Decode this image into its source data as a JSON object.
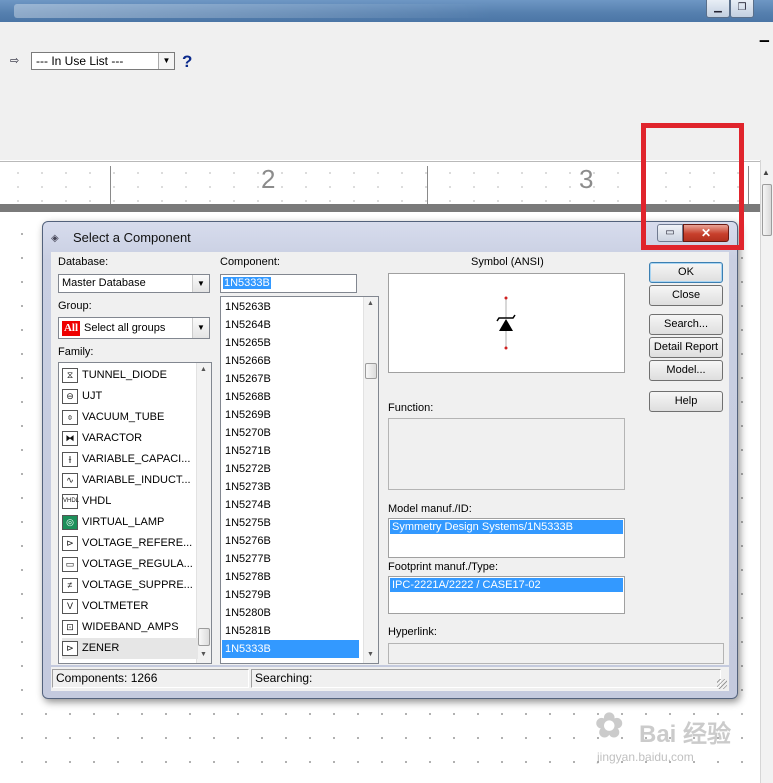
{
  "toolbar": {
    "inuse_value": "--- In Use List ---",
    "help_glyph": "?"
  },
  "ruler": {
    "labels": [
      "2",
      "3"
    ]
  },
  "dialog": {
    "title": "Select a Component",
    "database_label": "Database:",
    "database_value": "Master Database",
    "group_label": "Group:",
    "group_badge": "All",
    "group_value": "Select all groups",
    "family_label": "Family:",
    "family_items": [
      {
        "label": "TUNNEL_DIODE",
        "icon": "tunnel-diode-icon",
        "glyph": "⧖"
      },
      {
        "label": "UJT",
        "icon": "ujt-icon",
        "glyph": "⊖"
      },
      {
        "label": "VACUUM_TUBE",
        "icon": "vacuum-tube-icon",
        "glyph": "⌽"
      },
      {
        "label": "VARACTOR",
        "icon": "varactor-icon",
        "glyph": "⧓"
      },
      {
        "label": "VARIABLE_CAPACI...",
        "icon": "variable-capacitor-icon",
        "glyph": "⫲"
      },
      {
        "label": "VARIABLE_INDUCT...",
        "icon": "variable-inductor-icon",
        "glyph": "∿"
      },
      {
        "label": "VHDL",
        "icon": "vhdl-icon",
        "glyph": "VHDL"
      },
      {
        "label": "VIRTUAL_LAMP",
        "icon": "virtual-lamp-icon",
        "glyph": "◎"
      },
      {
        "label": "VOLTAGE_REFERE...",
        "icon": "voltage-reference-icon",
        "glyph": "⊳"
      },
      {
        "label": "VOLTAGE_REGULA...",
        "icon": "voltage-regulator-icon",
        "glyph": "▭"
      },
      {
        "label": "VOLTAGE_SUPPRE...",
        "icon": "voltage-suppressor-icon",
        "glyph": "≠"
      },
      {
        "label": "VOLTMETER",
        "icon": "voltmeter-icon",
        "glyph": "V"
      },
      {
        "label": "WIDEBAND_AMPS",
        "icon": "wideband-amps-icon",
        "glyph": "⊡"
      },
      {
        "label": "ZENER",
        "icon": "zener-icon",
        "glyph": "⊳"
      }
    ],
    "component_label": "Component:",
    "component_value": "1N5333B",
    "component_items": [
      "1N5263B",
      "1N5264B",
      "1N5265B",
      "1N5266B",
      "1N5267B",
      "1N5268B",
      "1N5269B",
      "1N5270B",
      "1N5271B",
      "1N5272B",
      "1N5273B",
      "1N5274B",
      "1N5275B",
      "1N5276B",
      "1N5277B",
      "1N5278B",
      "1N5279B",
      "1N5280B",
      "1N5281B",
      "1N5333B"
    ],
    "symbol_label": "Symbol (ANSI)",
    "function_label": "Function:",
    "model_label": "Model manuf./ID:",
    "model_value": "Symmetry Design Systems/1N5333B",
    "footprint_label": "Footprint manuf./Type:",
    "footprint_value": "IPC-2221A/2222 / CASE17-02",
    "hyperlink_label": "Hyperlink:",
    "buttons": {
      "ok": "OK",
      "close": "Close",
      "search": "Search...",
      "detail_report": "Detail Report",
      "model": "Model...",
      "help": "Help"
    },
    "status_components": "Components: 1266",
    "status_searching": "Searching:"
  },
  "watermark": {
    "brand": "Bai 经验",
    "url": "jingyan.baidu.com"
  },
  "colors": {
    "selection": "#3399ff",
    "annotation": "#e0242c"
  }
}
